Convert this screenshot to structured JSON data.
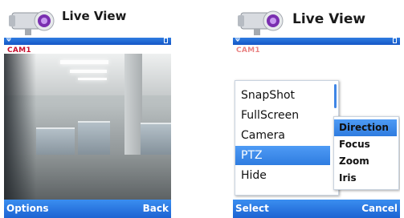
{
  "screens": [
    {
      "title": "Live View",
      "camera_label": "CAM1",
      "softkeys": {
        "left": "Options",
        "right": "Back"
      }
    },
    {
      "title": "Live View",
      "camera_label": "CAM1",
      "softkeys": {
        "left": "Select",
        "right": "Cancel"
      },
      "menu": {
        "items": [
          "SnapShot",
          "FullScreen",
          "Camera",
          "PTZ",
          "Hide"
        ],
        "selected": "PTZ"
      },
      "submenu": {
        "items": [
          "Direction",
          "Focus",
          "Zoom",
          "Iris"
        ],
        "selected": "Direction"
      }
    }
  ],
  "icons": {
    "app": "security-camera-icon",
    "signal": "signal-antenna-icon",
    "battery": "battery-icon"
  },
  "colors": {
    "accent": "#2f7ce0",
    "camera_label": "#c8102e"
  }
}
